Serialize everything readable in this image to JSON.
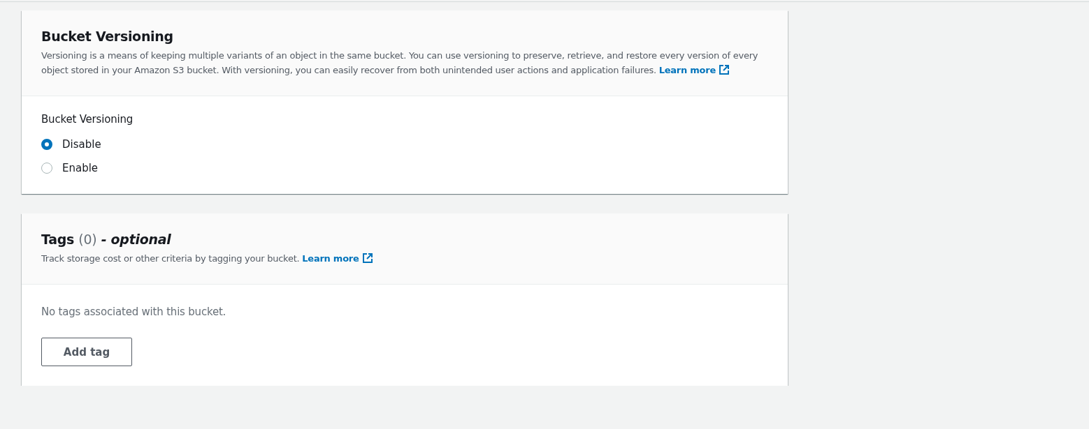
{
  "versioning": {
    "title": "Bucket Versioning",
    "description": "Versioning is a means of keeping multiple variants of an object in the same bucket. You can use versioning to preserve, retrieve, and restore every version of every object stored in your Amazon S3 bucket. With versioning, you can easily recover from both unintended user actions and application failures.",
    "link": "Learn more",
    "field_label": "Bucket Versioning",
    "options": [
      {
        "label": "Disable",
        "selected": true
      },
      {
        "label": "Enable",
        "selected": false
      }
    ]
  },
  "tags": {
    "title": "Tags",
    "count": "(0)",
    "suffix": "- optional",
    "description": "Track storage cost or other criteria by tagging your bucket.",
    "link": "Learn more",
    "empty_text": "No tags associated with this bucket.",
    "button": "Add tag"
  }
}
